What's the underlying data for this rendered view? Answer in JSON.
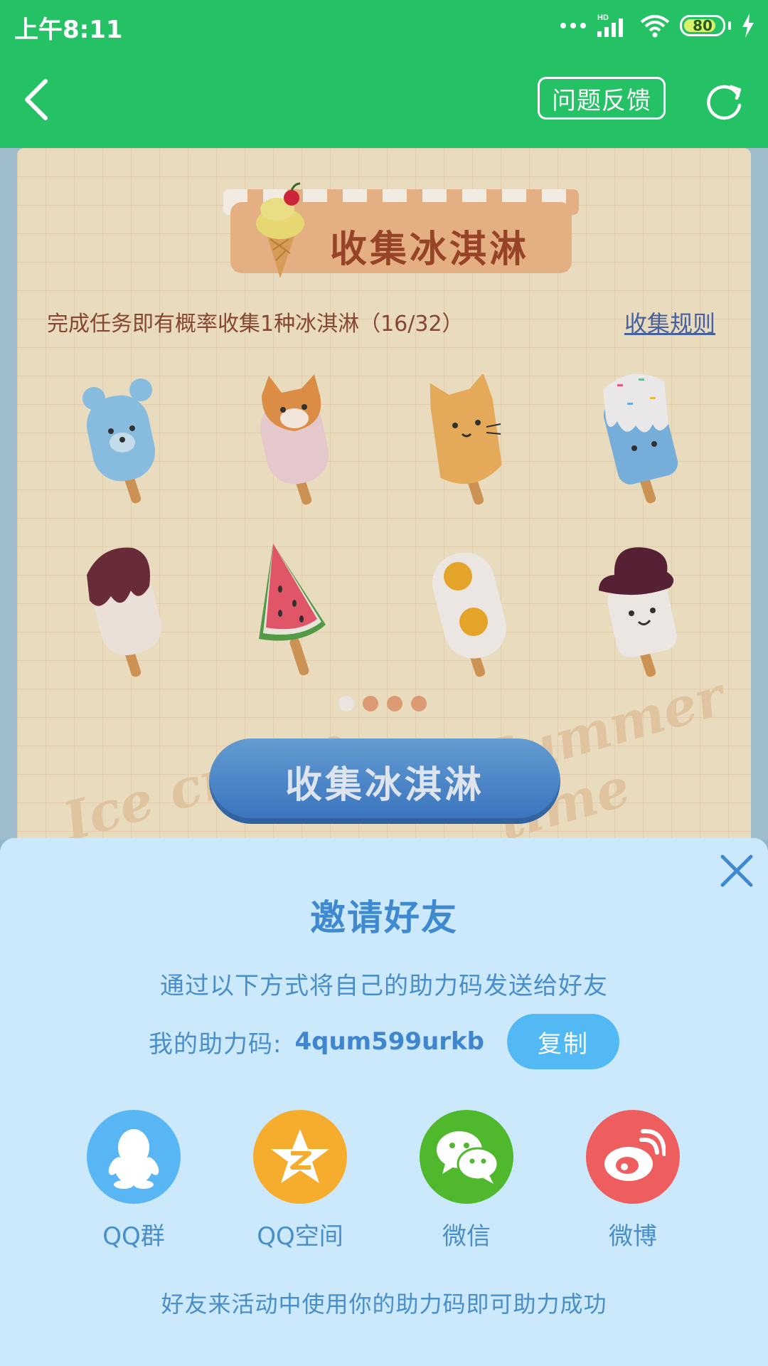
{
  "status_bar": {
    "time": "上午8:11",
    "network": "HD",
    "battery": "80"
  },
  "header": {
    "feedback_label": "问题反馈"
  },
  "background_page": {
    "title": "收集冰淇淋",
    "progress_text": "完成任务即有概率收集1种冰淇淋（16/32）",
    "rules_link": "收集规则",
    "popsicles": [
      "bear-popsicle-icon",
      "fox-popsicle-icon",
      "cat-popsicle-icon",
      "sprinkle-popsicle-icon",
      "chocolate-popsicle-icon",
      "watermelon-popsicle-icon",
      "egg-popsicle-icon",
      "hat-popsicle-icon"
    ],
    "pagination": {
      "current": 1,
      "total": 4
    },
    "collect_button": "收集冰淇淋",
    "deco_left": "Ice cream",
    "deco_right": "Summer time"
  },
  "invite_sheet": {
    "title": "邀请好友",
    "description": "通过以下方式将自己的助力码发送给好友",
    "code_label": "我的助力码:",
    "code_value": "4qum599urkb",
    "copy_label": "复制",
    "share_options": [
      {
        "label": "QQ群",
        "icon": "qq-penguin-icon",
        "color": "#58b6f4"
      },
      {
        "label": "QQ空间",
        "icon": "qzone-star-icon",
        "color": "#f6ad2d"
      },
      {
        "label": "微信",
        "icon": "wechat-icon",
        "color": "#50b82c"
      },
      {
        "label": "微博",
        "icon": "weibo-icon",
        "color": "#ee5e5e"
      }
    ],
    "footer": "好友来活动中使用你的助力码即可助力成功"
  },
  "colors": {
    "header_green": "#25c265",
    "sheet_bg": "#cbe9fb",
    "accent_blue": "#3f89d1"
  }
}
